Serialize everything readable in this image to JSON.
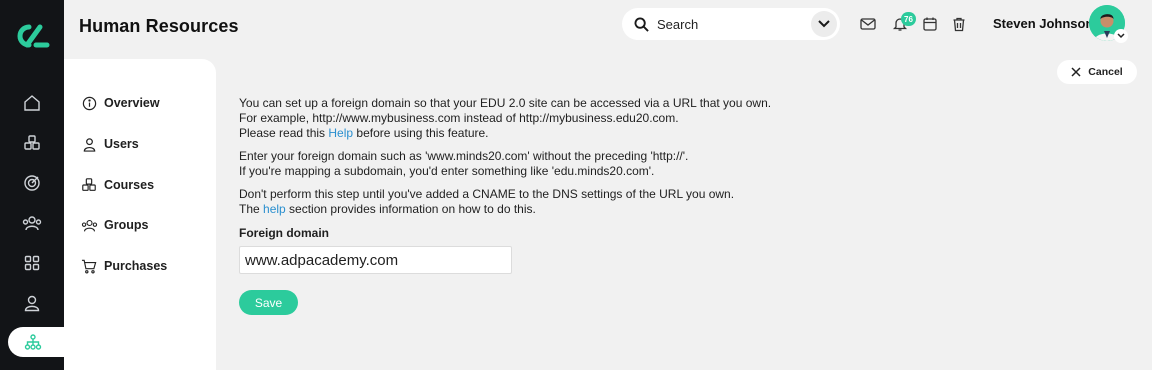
{
  "app": {
    "title": "Human Resources"
  },
  "header": {
    "search_label": "Search",
    "notification_count": "76",
    "user_name": "Steven Johnson"
  },
  "sidebar": {
    "items": [
      {
        "label": "Overview",
        "icon": "info-icon"
      },
      {
        "label": "Users",
        "icon": "user-icon"
      },
      {
        "label": "Courses",
        "icon": "courses-icon"
      },
      {
        "label": "Groups",
        "icon": "groups-icon"
      },
      {
        "label": "Purchases",
        "icon": "cart-icon"
      }
    ]
  },
  "actions": {
    "cancel_label": "Cancel",
    "save_label": "Save"
  },
  "content": {
    "p1_l1": "You can set up a foreign domain so that your EDU 2.0 site can be accessed via a URL that you own.",
    "p1_l2": "For example, http://www.mybusiness.com instead of http://mybusiness.edu20.com.",
    "p1_l3_pre": "Please read this ",
    "p1_l3_link": "Help",
    "p1_l3_post": " before using this feature.",
    "p2_l1": "Enter your foreign domain such as 'www.minds20.com' without the preceding 'http://'.",
    "p2_l2": "If you're mapping a subdomain, you'd enter something like 'edu.minds20.com'.",
    "p3_l1": "Don't perform this step until you've added a CNAME to the DNS settings of the URL you own.",
    "p3_l2_pre": "The ",
    "p3_l2_link": "help",
    "p3_l2_post": " section provides information on how to do this."
  },
  "form": {
    "label": "Foreign domain",
    "value": "www.adpacademy.com"
  },
  "colors": {
    "accent": "#2ccb9c",
    "rail": "#121417",
    "link": "#2a8fcf"
  }
}
